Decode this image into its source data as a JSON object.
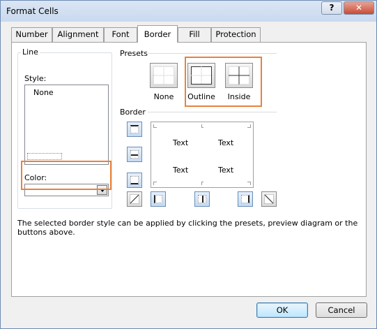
{
  "window": {
    "title": "Format Cells",
    "help_glyph": "?",
    "close_glyph": "✕"
  },
  "tabs": [
    {
      "label": "Number"
    },
    {
      "label": "Alignment"
    },
    {
      "label": "Font"
    },
    {
      "label": "Border",
      "active": true
    },
    {
      "label": "Fill"
    },
    {
      "label": "Protection"
    }
  ],
  "line_group": {
    "label": "Line",
    "style_label": "Style:",
    "style_selected": "None",
    "color_label": "Color:",
    "color_value": ""
  },
  "presets": {
    "label": "Presets",
    "items": [
      {
        "label": "None"
      },
      {
        "label": "Outline"
      },
      {
        "label": "Inside"
      }
    ]
  },
  "border": {
    "label": "Border",
    "preview_texts": [
      "Text",
      "Text",
      "Text",
      "Text"
    ],
    "buttons": [
      {
        "name": "top-border-icon"
      },
      {
        "name": "inside-horizontal-border-icon"
      },
      {
        "name": "bottom-border-icon"
      },
      {
        "name": "diagonal-up-border-icon"
      },
      {
        "name": "left-border-icon"
      },
      {
        "name": "inside-vertical-border-icon"
      },
      {
        "name": "right-border-icon"
      },
      {
        "name": "diagonal-down-border-icon"
      }
    ]
  },
  "help_text": "The selected border style can be applied by clicking the presets, preview diagram or the buttons above.",
  "buttons": {
    "ok": "OK",
    "cancel": "Cancel"
  },
  "colors": {
    "highlight": "#e8823d",
    "titlebar": "#c9d9ee",
    "close_button": "#c64c36"
  }
}
